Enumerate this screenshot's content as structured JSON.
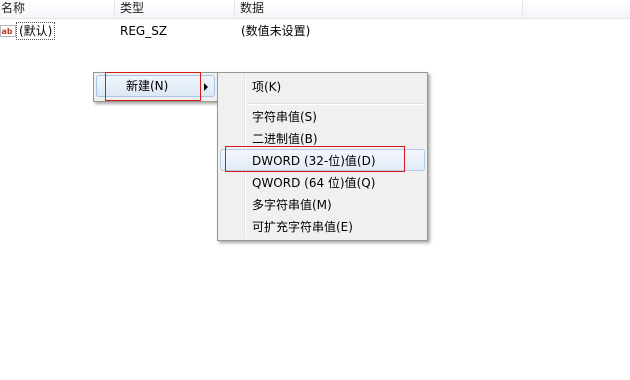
{
  "columns": {
    "name": "名称",
    "type": "类型",
    "data": "数据"
  },
  "value_row": {
    "icon": "string-value-icon",
    "icon_text": "ab",
    "name": "(默认)",
    "type": "REG_SZ",
    "data": "(数值未设置)"
  },
  "context_menu": {
    "new_label": "新建(N)",
    "arrow_icon": "submenu-arrow-icon"
  },
  "submenu": {
    "key": "项(K)",
    "string_value": "字符串值(S)",
    "binary_value": "二进制值(B)",
    "dword_value": "DWORD (32-位)值(D)",
    "qword_value": "QWORD (64 位)值(Q)",
    "multi_string_value": "多字符串值(M)",
    "expandable_string_value": "可扩充字符串值(E)"
  },
  "colors": {
    "highlight_box": "#d51a1a",
    "menu_background": "#f0f0f0",
    "hover_border": "#a8c4e6"
  }
}
